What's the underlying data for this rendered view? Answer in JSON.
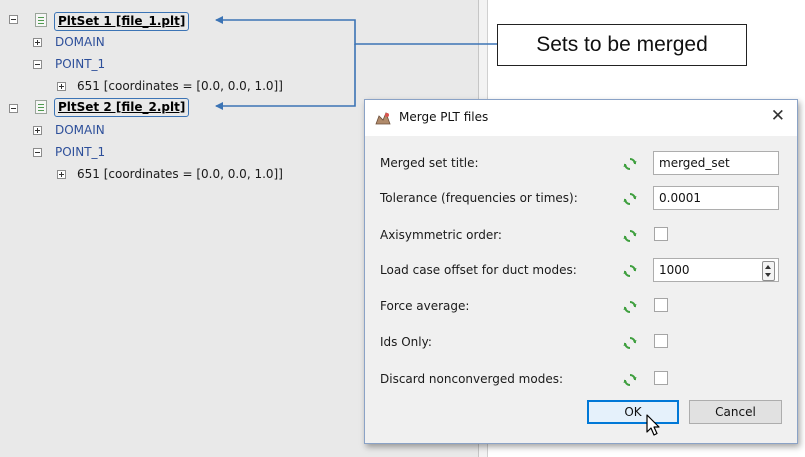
{
  "tree": {
    "set1": {
      "title": "PltSet 1 [file_1.plt]",
      "children": {
        "domain": "DOMAIN",
        "point": "POINT_1",
        "entry": "651 [coordinates = [0.0, 0.0, 1.0]]"
      }
    },
    "set2": {
      "title": "PltSet 2 [file_2.plt]",
      "children": {
        "domain": "DOMAIN",
        "point": "POINT_1",
        "entry": "651 [coordinates = [0.0, 0.0, 1.0]]"
      }
    }
  },
  "callout": {
    "text": "Sets to be merged"
  },
  "dialog": {
    "title": "Merge PLT files",
    "close_glyph": "✕",
    "fields": {
      "merged_title": {
        "label": "Merged set title:",
        "value": "merged_set"
      },
      "tolerance": {
        "label": "Tolerance (frequencies or times):",
        "value": "0.0001"
      },
      "axisymmetric": {
        "label": "Axisymmetric order:",
        "checked": false
      },
      "load_case_offset": {
        "label": "Load case offset for duct modes:",
        "value": "1000"
      },
      "force_average": {
        "label": "Force average:",
        "checked": false
      },
      "ids_only": {
        "label": "Ids Only:",
        "checked": false
      },
      "discard_nonconverged": {
        "label": "Discard nonconverged modes:",
        "checked": false
      }
    },
    "buttons": {
      "ok": "OK",
      "cancel": "Cancel"
    }
  },
  "colors": {
    "accent": "#3c74b5",
    "tree_background": "#e9e9e9",
    "dialog_background": "#f0f0f0",
    "reset_icon": "#3f9f3f"
  },
  "icons": {
    "reset": "green-reset-arrows-icon",
    "app": "merge-app-icon",
    "cursor": "mouse-pointer-icon"
  }
}
